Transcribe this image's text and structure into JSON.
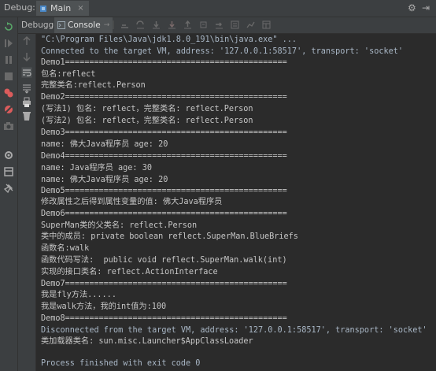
{
  "window": {
    "debug_label": "Debug:",
    "run_tab": "Main",
    "run_tab_close": "×"
  },
  "tabs": [
    {
      "label": "Debugger"
    },
    {
      "label": "Console",
      "close": "→"
    }
  ],
  "console": {
    "lines": [
      "\"C:\\Program Files\\Java\\jdk1.8.0_191\\bin\\java.exe\" ...",
      "Connected to the target VM, address: '127.0.0.1:58517', transport: 'socket'",
      "Demo1==============================================",
      "包名:reflect",
      "完整类名:reflect.Person",
      "Demo2==============================================",
      "(写法1) 包名: reflect，完整类名: reflect.Person",
      "(写法2) 包名: reflect，完整类名: reflect.Person",
      "Demo3==============================================",
      "name: 佛大Java程序员 age: 20",
      "Demo4==============================================",
      "name: Java程序员 age: 30",
      "name: 佛大Java程序员 age: 20",
      "Demo5==============================================",
      "修改属性之后得到属性变量的值: 佛大Java程序员",
      "Demo6==============================================",
      "SuperMan类的父类名: reflect.Person",
      "类中的成员: private boolean reflect.SuperMan.BlueBriefs",
      "函数名:walk",
      "函数代码写法:  public void reflect.SuperMan.walk(int)",
      "实现的接口类名: reflect.ActionInterface",
      "Demo7==============================================",
      "我是fly方法......",
      "我是walk方法，我的int值为:100",
      "Demo8==============================================",
      "Disconnected from the target VM, address: '127.0.0.1:58517', transport: 'socket'",
      "类加载器类名: sun.misc.Launcher$AppClassLoader",
      "",
      "Process finished with exit code 0"
    ]
  },
  "icons": {
    "toolbar": [
      "gear-icon",
      "settings-icon",
      "rerun-icon",
      "resume-icon",
      "pause-icon",
      "stop-icon",
      "view-breakpoints-icon",
      "mute-breakpoints-icon",
      "camera-icon",
      "layout-icon",
      "pin-icon",
      "scroll-icon",
      "print-icon",
      "trash-icon"
    ]
  }
}
